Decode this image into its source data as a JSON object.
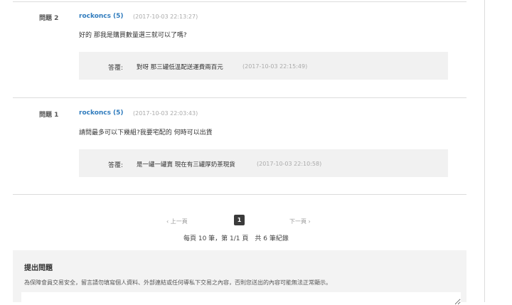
{
  "questions": [
    {
      "label": "問題 2",
      "user": "rockoncs",
      "count": "(5)",
      "time": "(2017-10-03 22:13:27)",
      "text": "好的 那我是購買數量選三就可以了嗎?",
      "answer_label": "答覆:",
      "answer_text": "對呀 那三罐低溫配送運費兩百元",
      "answer_time": "(2017-10-03 22:15:49)"
    },
    {
      "label": "問題 1",
      "user": "rockoncs",
      "count": "(5)",
      "time": "(2017-10-03 22:03:43)",
      "text": "請問最多可以下幾組?我要宅配的 何時可以出貨",
      "answer_label": "答覆:",
      "answer_text": "是一罐一罐賣 現在有三罐厚奶茶現貨",
      "answer_time": "(2017-10-03 22:10:58)"
    }
  ],
  "pagination": {
    "prev": "‹ 上一頁",
    "current": "1",
    "next": "下一頁 ›",
    "summary": "每頁 10 筆，第 1/1 頁　共 6 筆紀錄"
  },
  "ask": {
    "title": "提出問題",
    "note": "為保障會員交易安全，留言請勿填寫個人資料、外部連結或任何導私下交易之內容，否則您送出的內容可能無法正常顯示。",
    "placeholder": ""
  }
}
